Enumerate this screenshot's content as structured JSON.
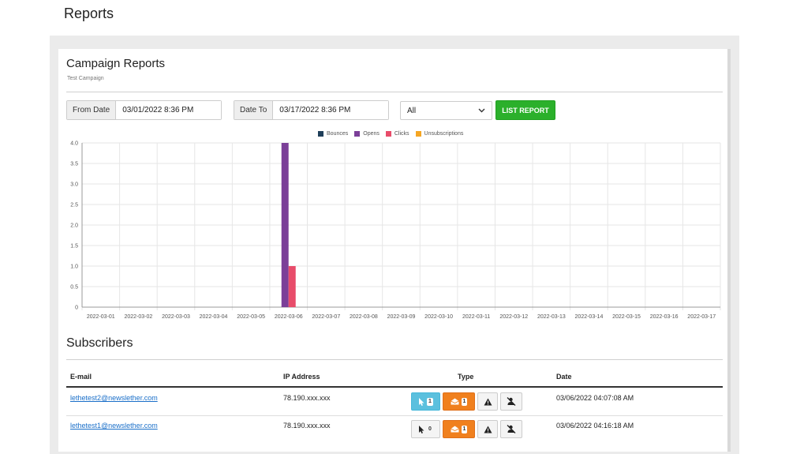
{
  "page": {
    "title": "Reports"
  },
  "card": {
    "title": "Campaign Reports",
    "subtitle": "Test Campaign"
  },
  "filters": {
    "from_label": "From Date",
    "from_value": "03/01/2022 8:36 PM",
    "to_label": "Date To",
    "to_value": "03/17/2022 8:36 PM",
    "select_value": "All",
    "list_button": "LIST REPORT"
  },
  "legend": [
    {
      "name": "Bounces",
      "color": "#1f3f5a"
    },
    {
      "name": "Opens",
      "color": "#7b3f98"
    },
    {
      "name": "Clicks",
      "color": "#e84c6a"
    },
    {
      "name": "Unsubscriptions",
      "color": "#f5a623"
    }
  ],
  "chart_data": {
    "type": "bar",
    "categories": [
      "2022-03-01",
      "2022-03-02",
      "2022-03-03",
      "2022-03-04",
      "2022-03-05",
      "2022-03-06",
      "2022-03-07",
      "2022-03-08",
      "2022-03-09",
      "2022-03-10",
      "2022-03-11",
      "2022-03-12",
      "2022-03-13",
      "2022-03-14",
      "2022-03-15",
      "2022-03-16",
      "2022-03-17"
    ],
    "series": [
      {
        "name": "Bounces",
        "color": "#1f3f5a",
        "values": [
          0,
          0,
          0,
          0,
          0,
          0,
          0,
          0,
          0,
          0,
          0,
          0,
          0,
          0,
          0,
          0,
          0
        ]
      },
      {
        "name": "Opens",
        "color": "#7b3f98",
        "values": [
          0,
          0,
          0,
          0,
          0,
          4,
          0,
          0,
          0,
          0,
          0,
          0,
          0,
          0,
          0,
          0,
          0
        ]
      },
      {
        "name": "Clicks",
        "color": "#e84c6a",
        "values": [
          0,
          0,
          0,
          0,
          0,
          1,
          0,
          0,
          0,
          0,
          0,
          0,
          0,
          0,
          0,
          0,
          0
        ]
      },
      {
        "name": "Unsubscriptions",
        "color": "#f5a623",
        "values": [
          0,
          0,
          0,
          0,
          0,
          0,
          0,
          0,
          0,
          0,
          0,
          0,
          0,
          0,
          0,
          0,
          0
        ]
      }
    ],
    "ylim": [
      0,
      4
    ],
    "yticks": [
      "0",
      "0.5",
      "1.0",
      "1.5",
      "2.0",
      "2.5",
      "3.0",
      "3.5",
      "4.0"
    ],
    "legend_position": "top-center",
    "grid": true
  },
  "subscribers": {
    "title": "Subscribers",
    "headers": {
      "email": "E-mail",
      "ip": "IP Address",
      "type": "Type",
      "date": "Date"
    },
    "rows": [
      {
        "email": "lethetest2@newslether.com",
        "ip": "78.190.xxx.xxx",
        "clicks": "1",
        "opens": "1",
        "date": "03/06/2022 04:07:08 AM"
      },
      {
        "email": "lethetest1@newslether.com",
        "ip": "78.190.xxx.xxx",
        "clicks": "0",
        "opens": "1",
        "date": "03/06/2022 04:16:18 AM"
      }
    ]
  }
}
